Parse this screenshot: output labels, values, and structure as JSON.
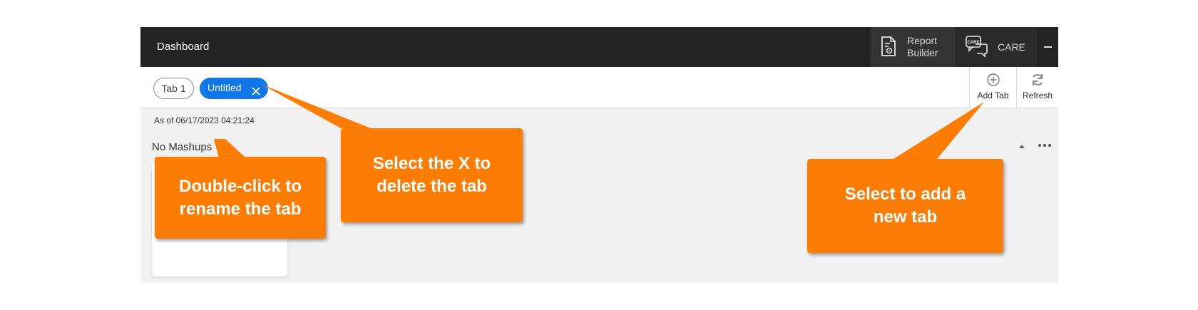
{
  "header": {
    "title": "Dashboard",
    "report_builder": {
      "line1": "Report",
      "line2": "Builder",
      "icon": "report-builder-icon"
    },
    "care": {
      "label": "CARE",
      "icon": "care-chat-icon",
      "icon_text": "CARE"
    }
  },
  "tabs": {
    "items": [
      {
        "label": "Tab 1",
        "active": false
      },
      {
        "label": "Untitled",
        "active": true
      }
    ],
    "close_icon": "close-icon",
    "add_tab_label": "Add Tab",
    "refresh_label": "Refresh",
    "active_color": "#1177e8"
  },
  "content": {
    "as_of": "As of 06/17/2023 04:21:24",
    "empty_message": "No Mashups"
  },
  "callouts": {
    "rename": {
      "line1": "Double-click to",
      "line2": "rename the tab"
    },
    "delete": {
      "line1": "Select the X to",
      "line2": "delete the tab"
    },
    "add": {
      "line1": "Select to add a",
      "line2": "new tab"
    },
    "color": "#fb7d06"
  }
}
